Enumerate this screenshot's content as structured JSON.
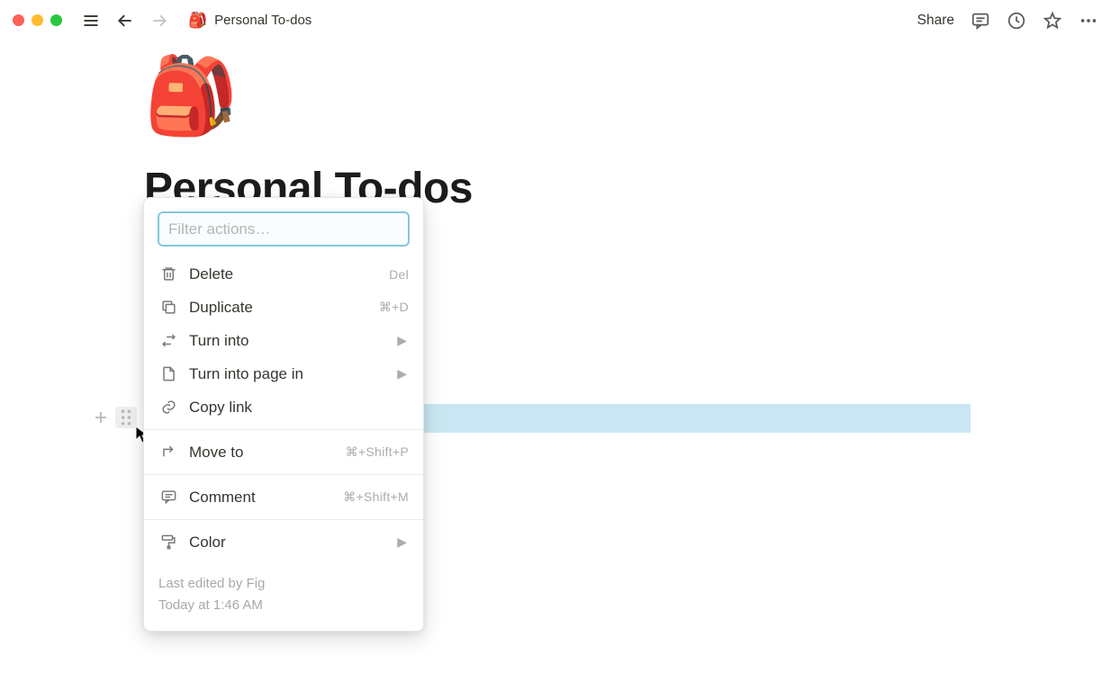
{
  "topbar": {
    "breadcrumb_emoji": "🎒",
    "breadcrumb_title": "Personal To-dos",
    "share_label": "Share"
  },
  "page": {
    "icon_emoji": "🎒",
    "title": "Personal To-dos"
  },
  "menu": {
    "filter_placeholder": "Filter actions…",
    "items": {
      "delete": {
        "label": "Delete",
        "shortcut": "Del"
      },
      "duplicate": {
        "label": "Duplicate",
        "shortcut": "⌘+D"
      },
      "turn_into": {
        "label": "Turn into",
        "submenu": true
      },
      "turn_into_page": {
        "label": "Turn into page in",
        "submenu": true
      },
      "copy_link": {
        "label": "Copy link"
      },
      "move_to": {
        "label": "Move to",
        "shortcut": "⌘+Shift+P"
      },
      "comment": {
        "label": "Comment",
        "shortcut": "⌘+Shift+M"
      },
      "color": {
        "label": "Color",
        "submenu": true
      }
    },
    "footer_line1": "Last edited by Fig",
    "footer_line2": "Today at 1:46 AM"
  }
}
